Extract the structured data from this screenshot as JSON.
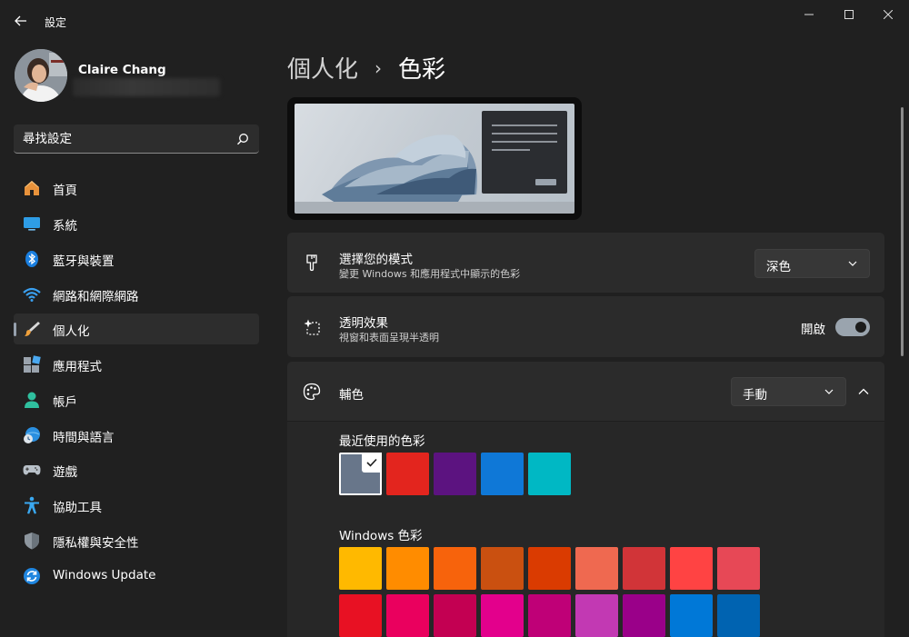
{
  "app": {
    "title": "設定",
    "back_icon": "arrow-left-icon",
    "window_controls": [
      "minimize-icon",
      "maximize-icon",
      "close-icon"
    ]
  },
  "user": {
    "name": "Claire Chang",
    "avatar_icon": "user-avatar"
  },
  "search": {
    "placeholder": "尋找設定",
    "icon": "search-icon"
  },
  "nav": {
    "items": [
      {
        "label": "首頁",
        "icon": "home-icon",
        "active": false
      },
      {
        "label": "系統",
        "icon": "monitor-icon",
        "active": false
      },
      {
        "label": "藍牙與裝置",
        "icon": "bluetooth-icon",
        "active": false
      },
      {
        "label": "網路和網際網路",
        "icon": "wifi-icon",
        "active": false
      },
      {
        "label": "個人化",
        "icon": "paintbrush-icon",
        "active": true
      },
      {
        "label": "應用程式",
        "icon": "apps-icon",
        "active": false
      },
      {
        "label": "帳戶",
        "icon": "person-icon",
        "active": false
      },
      {
        "label": "時間與語言",
        "icon": "globe-clock-icon",
        "active": false
      },
      {
        "label": "遊戲",
        "icon": "gamepad-icon",
        "active": false
      },
      {
        "label": "協助工具",
        "icon": "accessibility-icon",
        "active": false
      },
      {
        "label": "隱私權與安全性",
        "icon": "shield-icon",
        "active": false
      },
      {
        "label": "Windows Update",
        "icon": "update-icon",
        "active": false
      }
    ]
  },
  "breadcrumb": {
    "parent": "個人化",
    "separator": "›",
    "current": "色彩"
  },
  "mode_card": {
    "icon": "brush-icon",
    "title": "選擇您的模式",
    "subtitle": "變更 Windows 和應用程式中顯示的色彩",
    "selected": "深色"
  },
  "transparency_card": {
    "icon": "sparkle-icon",
    "title": "透明效果",
    "subtitle": "視窗和表面呈現半透明",
    "toggle_label": "開啟",
    "toggle_on": true
  },
  "accent_card": {
    "icon": "palette-icon",
    "title": "輔色",
    "selected": "手動",
    "expanded": true
  },
  "recent_colors": {
    "label": "最近使用的色彩",
    "colors": [
      "#68768a",
      "#e3251e",
      "#5c1380",
      "#0f78d7",
      "#00b8c4"
    ],
    "selected_index": 0
  },
  "windows_colors": {
    "label": "Windows 色彩",
    "row1": [
      "#ffb900",
      "#ff8c00",
      "#f7630c",
      "#ca5010",
      "#da3b01",
      "#ef6950",
      "#d13438",
      "#ff4343",
      "#e74856"
    ],
    "row2": [
      "#e81123",
      "#ea005e",
      "#c30052",
      "#e3008c",
      "#bf0077",
      "#c239b3",
      "#9a0089",
      "#0078d7",
      "#0063b1"
    ]
  }
}
